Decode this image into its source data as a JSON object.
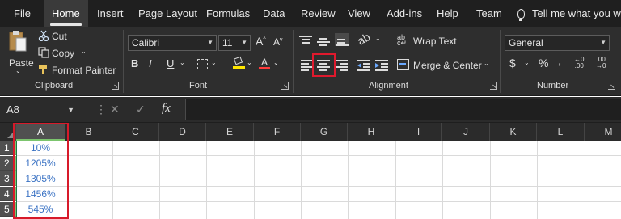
{
  "tabs": [
    {
      "label": "File",
      "active": false
    },
    {
      "label": "Home",
      "active": true
    },
    {
      "label": "Insert",
      "active": false
    },
    {
      "label": "Page Layout",
      "active": false
    },
    {
      "label": "Formulas",
      "active": false
    },
    {
      "label": "Data",
      "active": false
    },
    {
      "label": "Review",
      "active": false
    },
    {
      "label": "View",
      "active": false
    },
    {
      "label": "Add-ins",
      "active": false
    },
    {
      "label": "Help",
      "active": false
    },
    {
      "label": "Team",
      "active": false
    }
  ],
  "tell_me": "Tell me what you wa",
  "clipboard": {
    "paste": "Paste",
    "cut": "Cut",
    "copy": "Copy",
    "format_painter": "Format Painter",
    "label": "Clipboard"
  },
  "font": {
    "family": "Calibri",
    "size": "11",
    "grow_glyph": "A",
    "shrink_glyph": "A",
    "bold": "B",
    "italic": "I",
    "underline": "U",
    "label": "Font"
  },
  "alignment": {
    "wrap_text": "Wrap Text",
    "merge_center": "Merge & Center",
    "label": "Alignment",
    "selected_button": "center-align"
  },
  "number": {
    "format": "General",
    "currency": "$",
    "percent": "%",
    "comma": ",",
    "label": "Number"
  },
  "formula_bar": {
    "name_box": "A8",
    "fx": "fx",
    "content": ""
  },
  "grid": {
    "columns": [
      "A",
      "B",
      "C",
      "D",
      "E",
      "F",
      "G",
      "H",
      "I",
      "J",
      "K",
      "L",
      "M"
    ],
    "selected_column": "A",
    "rows": [
      {
        "num": "1",
        "a": "10%"
      },
      {
        "num": "2",
        "a": "1205%"
      },
      {
        "num": "3",
        "a": "1305%"
      },
      {
        "num": "4",
        "a": "1456%"
      },
      {
        "num": "5",
        "a": "545%"
      }
    ]
  },
  "colors": {
    "accent_selection": "#d71a2a",
    "cell_text": "#3b73c4",
    "ribbon_bg": "#2e2e2e",
    "tabbar_bg": "#1f1f1f"
  }
}
